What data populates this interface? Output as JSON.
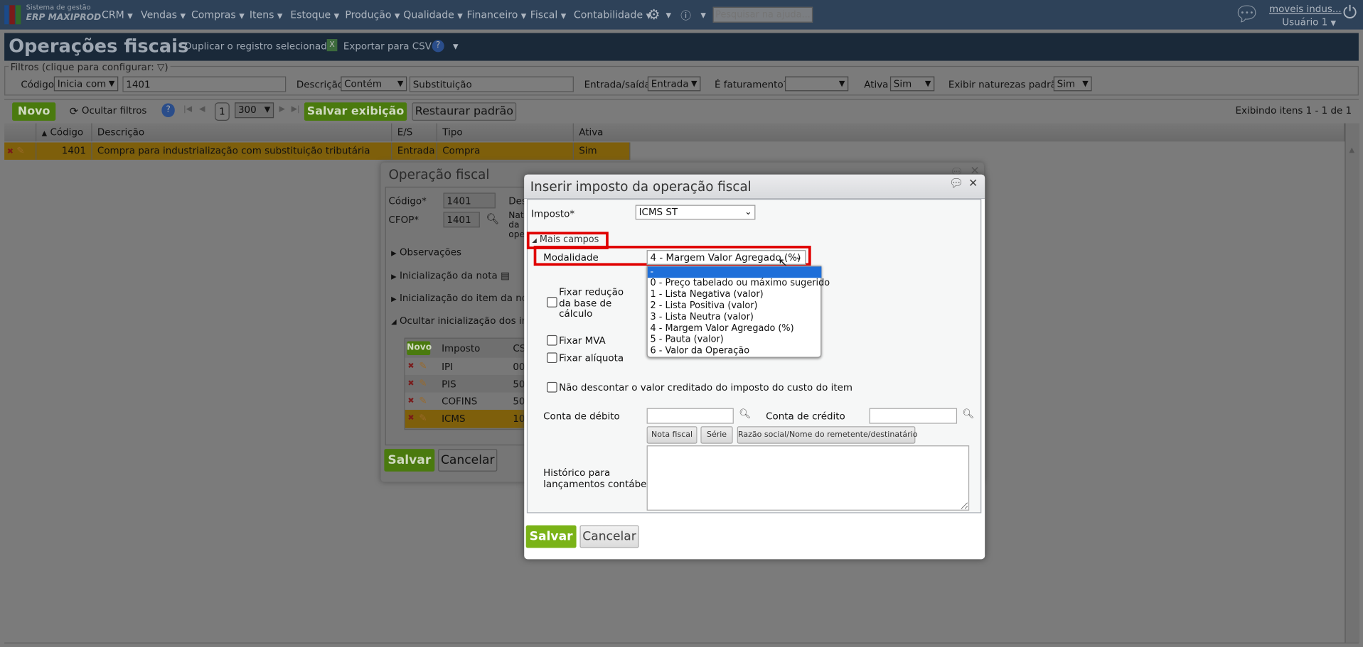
{
  "nav": {
    "logo_line1": "Sistema de gestão",
    "logo_line2": "ERP MAXIPROD",
    "menus": [
      "CRM",
      "Vendas",
      "Compras",
      "Itens",
      "Estoque",
      "Produção",
      "Qualidade",
      "Financeiro",
      "Fiscal",
      "Contabilidade"
    ],
    "search_placeholder": "Pesquisar na ajuda...",
    "company": "moveis indus...",
    "user": "Usuário 1"
  },
  "page": {
    "title": "Operações fiscais",
    "duplicate": "Duplicar o registro selecionado",
    "export": "Exportar para CSV"
  },
  "filters": {
    "legend": "Filtros (clique para configurar:",
    "legend_end": ")",
    "codigo_label": "Código",
    "codigo_op": "Inicia com",
    "codigo_value": "1401",
    "descricao_label": "Descrição",
    "descricao_op": "Contém",
    "descricao_value": "Substituição",
    "es_label": "Entrada/saída",
    "es_value": "Entrada",
    "fat_label": "É faturamento?",
    "fat_value": "",
    "ativa_label": "Ativa",
    "ativa_value": "Sim",
    "exibir_label": "Exibir naturezas padrão",
    "exibir_value": "Sim"
  },
  "toolbar": {
    "novo": "Novo",
    "ocultar": "Ocultar filtros",
    "page": "1",
    "page_size": "300",
    "salvar": "Salvar exibição",
    "restaurar": "Restaurar padrão",
    "count": "Exibindo itens 1 - 1 de 1"
  },
  "table": {
    "headers": [
      "Código",
      "Descrição",
      "E/S",
      "Tipo",
      "Ativa"
    ],
    "rows": [
      {
        "codigo": "1401",
        "descricao": "Compra para industrialização com substituição tributária",
        "es": "Entrada",
        "tipo": "Compra",
        "ativa": "Sim"
      }
    ]
  },
  "op_dialog": {
    "title": "Operação fiscal",
    "codigo_label": "Código*",
    "codigo": "1401",
    "cfop_label": "CFOP*",
    "cfop": "1401",
    "des_label": "Des",
    "nat_label": [
      "Nat",
      "da",
      "ope"
    ],
    "sections": [
      "Observações",
      "Inicialização da nota",
      "Inicialização do item da nota",
      "Ocultar inicialização dos impo"
    ],
    "tax_table": {
      "novo": "Novo",
      "headers": [
        "Imposto",
        "CS"
      ],
      "rows": [
        {
          "imposto": "IPI",
          "cs": "00"
        },
        {
          "imposto": "PIS",
          "cs": "50"
        },
        {
          "imposto": "COFINS",
          "cs": "50"
        },
        {
          "imposto": "ICMS",
          "cs": "10"
        }
      ]
    },
    "salvar": "Salvar",
    "cancelar": "Cancelar"
  },
  "tax_dialog": {
    "title": "Inserir imposto da operação fiscal",
    "imposto_label": "Imposto*",
    "imposto": "ICMS ST",
    "mais_campos": "Mais campos",
    "modalidade_label": "Modalidade",
    "modalidade": "4 - Margem Valor Agregado (%)",
    "modalidade_options": [
      "-",
      "0 - Preço tabelado ou máximo sugerido",
      "1 - Lista Negativa (valor)",
      "2 - Lista Positiva (valor)",
      "3 - Lista Neutra (valor)",
      "4 - Margem Valor Agregado (%)",
      "5 - Pauta (valor)",
      "6 - Valor da Operação"
    ],
    "fixar_reducao": [
      "Fixar redução",
      "da base de",
      "cálculo"
    ],
    "fixar_mva": "Fixar MVA",
    "fixar_aliquota": "Fixar alíquota",
    "nao_descontar": "Não descontar o valor creditado do imposto do custo do item",
    "conta_debito": "Conta de débito",
    "conta_credito": "Conta de crédito",
    "tokens": [
      "Nota fiscal",
      "Série",
      "Razão social/Nome do remetente/destinatário"
    ],
    "historico": [
      "Histórico para",
      "lançamentos contábeis"
    ],
    "salvar": "Salvar",
    "cancelar": "Cancelar"
  },
  "colors": {
    "accent_green": "#7ab317",
    "highlight_red": "#e00000",
    "selected_blue": "#1e6fd9"
  }
}
